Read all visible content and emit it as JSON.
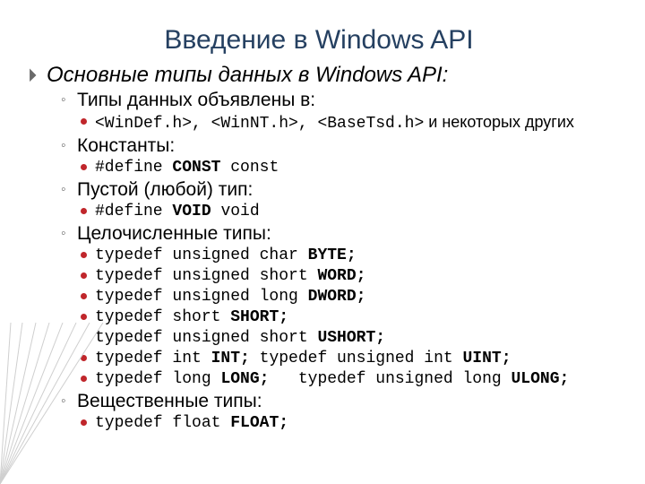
{
  "title": "Введение в Windows API",
  "h1": "Основные типы данных в Windows API:",
  "s_declared": "Типы данных объявлены в:",
  "headers_line_a": "<WinDef.h>, <WinNT.h>, <BaseTsd.h>",
  "headers_line_b": " и некоторых других",
  "s_const": "Константы:",
  "const_def_a": "#define ",
  "const_def_b": "CONST",
  "const_def_c": " const",
  "s_void": "Пустой (любой) тип:",
  "void_def_a": "#define ",
  "void_def_b": "VOID",
  "void_def_c": " void",
  "s_int": "Целочисленные типы:",
  "int1_a": "typedef unsigned char ",
  "int1_b": "BYTE;",
  "int2_a": "typedef unsigned short ",
  "int2_b": "WORD;",
  "int3_a": "typedef unsigned long ",
  "int3_b": "DWORD;",
  "int4_a": "typedef short ",
  "int4_b": "SHORT;",
  "int4b_a": "typedef unsigned short ",
  "int4b_b": "USHORT;",
  "int5_a": "typedef int ",
  "int5_b": "INT;",
  "int5_c": " typedef unsigned int ",
  "int5_d": "UINT;",
  "int6_a": "typedef long ",
  "int6_b": "LONG;",
  "int6_c": "   typedef unsigned long ",
  "int6_d": "ULONG;",
  "s_real": "Вещественные типы:",
  "real1_a": "typedef float ",
  "real1_b": "FLOAT;"
}
